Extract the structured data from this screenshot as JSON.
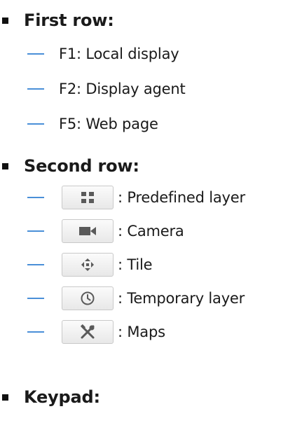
{
  "sections": {
    "first_row": {
      "title": "First row:",
      "items": [
        {
          "label": "F1: Local display"
        },
        {
          "label": "F2: Display agent"
        },
        {
          "label": "F5: Web page"
        }
      ]
    },
    "second_row": {
      "title": "Second row:",
      "items": [
        {
          "icon": "predefined-layer-icon",
          "label": ": Predefined layer"
        },
        {
          "icon": "camera-icon",
          "label": ": Camera"
        },
        {
          "icon": "tile-icon",
          "label": ": Tile"
        },
        {
          "icon": "clock-icon",
          "label": ": Temporary layer"
        },
        {
          "icon": "tools-icon",
          "label": ": Maps"
        }
      ]
    },
    "keypad": {
      "title": "Keypad:"
    }
  },
  "colors": {
    "dash": "#4a8fd8",
    "icon": "#5a5a5a"
  }
}
